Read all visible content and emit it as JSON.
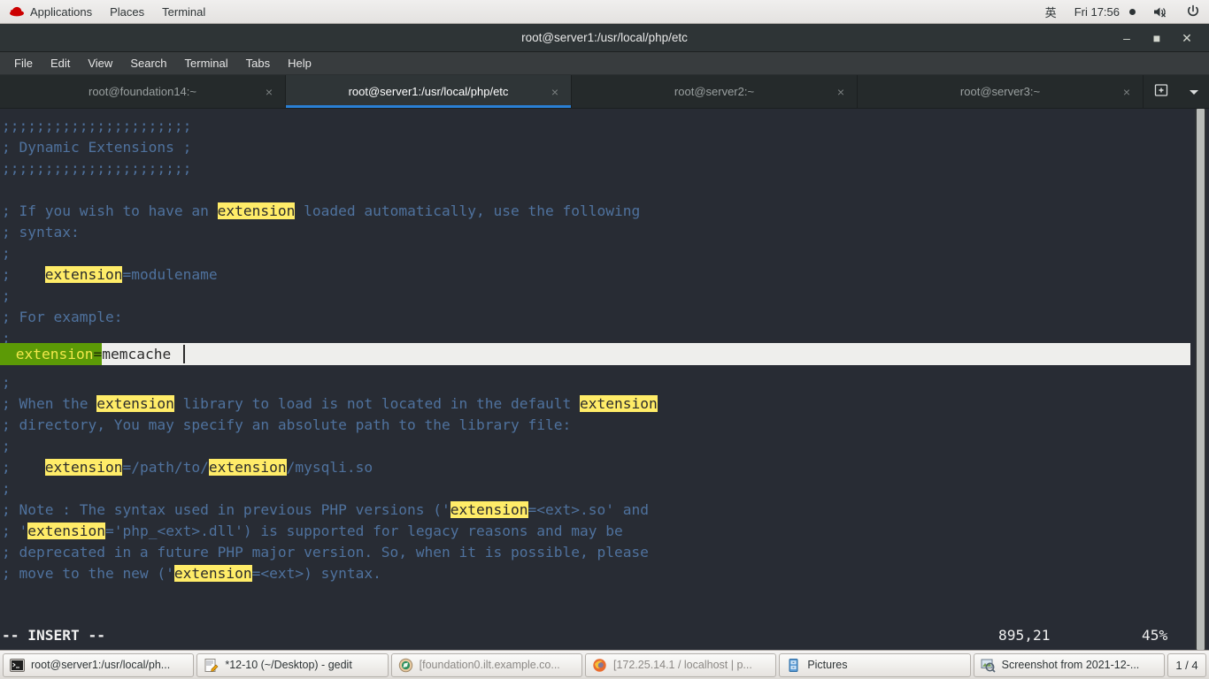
{
  "top_bar": {
    "logo_icon": "redhat-logo-icon",
    "items": [
      "Applications",
      "Places",
      "Terminal"
    ],
    "input_method": "英",
    "clock": "Fri 17:56",
    "volume_icon": "volume-muted-icon",
    "power_icon": "power-icon"
  },
  "window": {
    "title": "root@server1:/usr/local/php/etc",
    "minimize_label": "–",
    "maximize_label": "■",
    "close_label": "✕"
  },
  "menu_bar": {
    "items": [
      "File",
      "Edit",
      "View",
      "Search",
      "Terminal",
      "Tabs",
      "Help"
    ]
  },
  "tabs": {
    "items": [
      {
        "label": "root@foundation14:~",
        "active": false
      },
      {
        "label": "root@server1:/usr/local/php/etc",
        "active": true
      },
      {
        "label": "root@server2:~",
        "active": false
      },
      {
        "label": "root@server3:~",
        "active": false
      }
    ],
    "close_glyph": "×",
    "new_tab_icon": "new-tab-icon",
    "tab_menu_icon": "chevron-down-icon"
  },
  "terminal": {
    "lines": [
      ";;;;;;;;;;;;;;;;;;;;;;",
      "; Dynamic Extensions ;",
      ";;;;;;;;;;;;;;;;;;;;;;",
      "",
      "; If you wish to have an @extension@ loaded automatically, use the following",
      "; syntax:",
      ";",
      ";    @extension@=modulename",
      ";",
      "; For example:",
      ";"
    ],
    "current_line": {
      "prefix": " extension",
      "equals": "=",
      "value": "memcache"
    },
    "lines_after": [
      ";",
      "; When the @extension@ library to load is not located in the default @extension@",
      "; directory, You may specify an absolute path to the library file:",
      ";",
      ";    @extension@=/path/to/@extension@/mysqli.so",
      ";",
      "; Note : The syntax used in previous PHP versions ('@extension@=<ext>.so' and",
      "; '@extension@='php_<ext>.dll') is supported for legacy reasons and may be",
      "; deprecated in a future PHP major version. So, when it is possible, please",
      "; move to the new ('@extension@=<ext>) syntax."
    ],
    "status": {
      "mode": "-- INSERT --",
      "position": "895,21",
      "percent": "45%"
    },
    "colors": {
      "background": "#282c34",
      "comment": "#4f729e",
      "search_highlight": "#ffec68",
      "cursor_line_green": "#5c9a06",
      "cursor_line_text": "#f2e84b",
      "insert_field": "#eeeeec",
      "tab_accent": "#2a7fd4"
    }
  },
  "taskbar": {
    "items": [
      {
        "label": "root@server1:/usr/local/ph...",
        "icon": "terminal-icon",
        "dim": false
      },
      {
        "label": "*12-10 (~/Desktop) - gedit",
        "icon": "gedit-icon",
        "dim": false
      },
      {
        "label": "[foundation0.ilt.example.co...",
        "icon": "browser-icon",
        "dim": true
      },
      {
        "label": "[172.25.14.1 / localhost | p...",
        "icon": "firefox-icon",
        "dim": true
      },
      {
        "label": "Pictures",
        "icon": "file-manager-icon",
        "dim": false
      },
      {
        "label": "Screenshot from 2021-12-...",
        "icon": "image-viewer-icon",
        "dim": false
      }
    ],
    "workspace": "1 / 4"
  }
}
